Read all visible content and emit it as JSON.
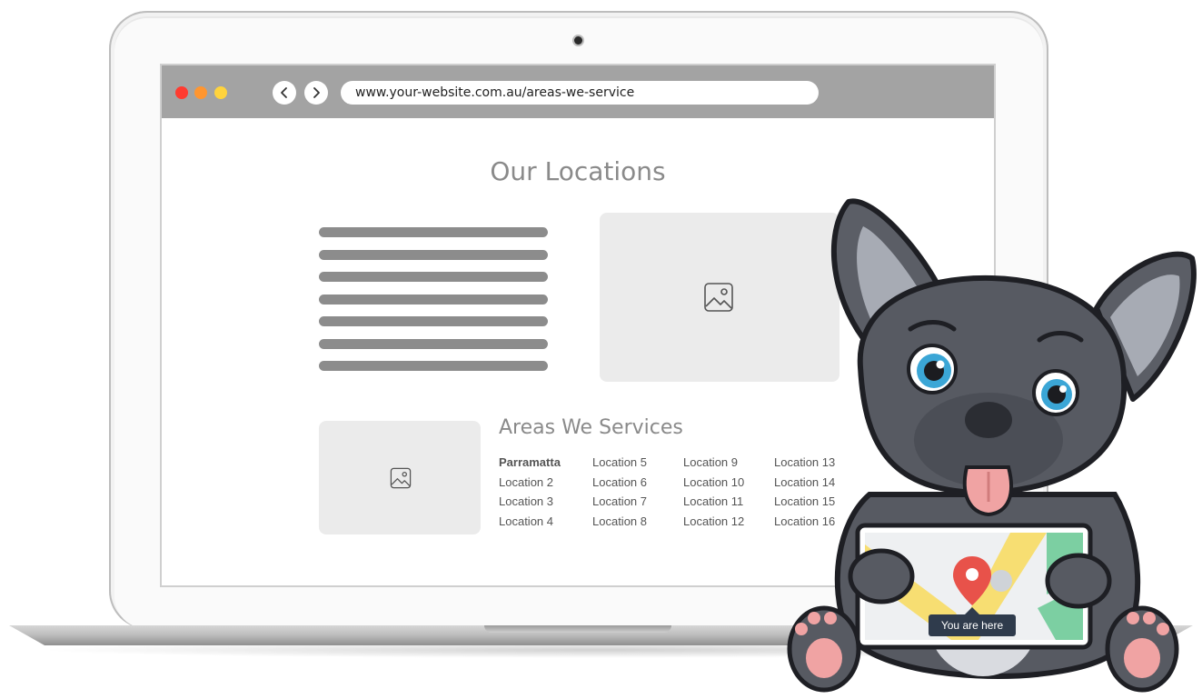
{
  "browser": {
    "url": "www.your-website.com.au/areas-we-service",
    "back_icon": "chevron-left-icon",
    "forward_icon": "chevron-right-icon",
    "window_controls": [
      "#ff3b30",
      "#ff9630",
      "#ffd33d"
    ]
  },
  "page": {
    "title": "Our Locations",
    "placeholder_icon": "image-icon",
    "areas_title": "Areas We Services",
    "locations": [
      "Parramatta",
      "Location 5",
      "Location 9",
      "Location 13",
      "Location 2",
      "Location 6",
      "Location 10",
      "Location 14",
      "Location 3",
      "Location 7",
      "Location 11",
      "Location 15",
      "Location 4",
      "Location 8",
      "Location 12",
      "Location 16"
    ]
  },
  "mascot": {
    "badge_text": "You are here",
    "pin_color": "#e8524a"
  }
}
